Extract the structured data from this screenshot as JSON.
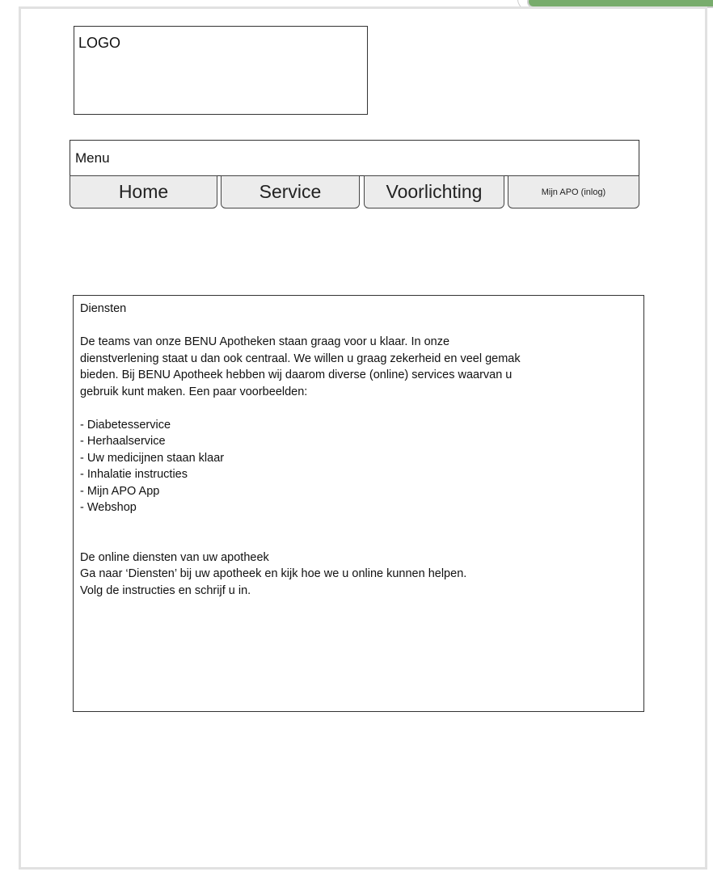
{
  "logo": {
    "label": "LOGO"
  },
  "menu": {
    "label": "Menu",
    "items": [
      {
        "label": "Home"
      },
      {
        "label": "Service"
      },
      {
        "label": "Voorlichting"
      },
      {
        "label": "Mijn APO (inlog)"
      }
    ]
  },
  "content": {
    "heading": "Diensten",
    "intro_lines": [
      "De teams van onze BENU Apotheken staan graag voor u klaar. In onze",
      "dienstverlening staat u dan ook centraal. We willen u graag zekerheid en veel gemak",
      "bieden. Bij BENU Apotheek hebben wij daarom diverse (online) services waarvan u",
      "gebruik kunt maken. Een paar voorbeelden:"
    ],
    "services": [
      "- Diabetesservice",
      "- Herhaalservice",
      "- Uw medicijnen staan klaar",
      "- Inhalatie instructies",
      "- Mijn APO App",
      "- Webshop"
    ],
    "online_heading": "De online diensten van uw apotheek",
    "online_lines": [
      "Ga naar ‘Diensten’ bij uw apotheek en kijk hoe we u online kunnen helpen.",
      "Volg de instructies en schrijf u in."
    ]
  },
  "colors": {
    "sheet_border": "#e1e1e1",
    "button_fill": "#ececec",
    "corner_tab": "#78ac6c"
  }
}
